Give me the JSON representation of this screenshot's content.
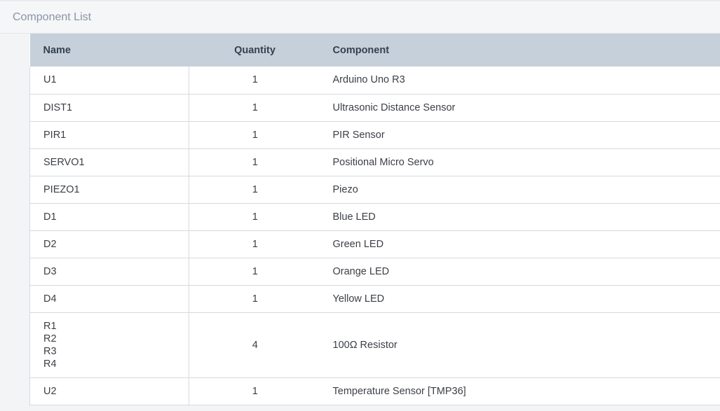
{
  "header": {
    "title": "Component List"
  },
  "table": {
    "columns": {
      "name": "Name",
      "quantity": "Quantity",
      "component": "Component"
    },
    "rows": [
      {
        "names": [
          "U1"
        ],
        "quantity": "1",
        "component": "Arduino Uno R3"
      },
      {
        "names": [
          "DIST1"
        ],
        "quantity": "1",
        "component": "Ultrasonic Distance Sensor"
      },
      {
        "names": [
          "PIR1"
        ],
        "quantity": "1",
        "component": "PIR Sensor"
      },
      {
        "names": [
          "SERVO1"
        ],
        "quantity": "1",
        "component": "Positional Micro Servo"
      },
      {
        "names": [
          "PIEZO1"
        ],
        "quantity": "1",
        "component": "Piezo"
      },
      {
        "names": [
          "D1"
        ],
        "quantity": "1",
        "component": "Blue LED"
      },
      {
        "names": [
          "D2"
        ],
        "quantity": "1",
        "component": "Green LED"
      },
      {
        "names": [
          "D3"
        ],
        "quantity": "1",
        "component": "Orange LED"
      },
      {
        "names": [
          "D4"
        ],
        "quantity": "1",
        "component": "Yellow LED"
      },
      {
        "names": [
          "R1",
          "R2",
          "R3",
          "R4"
        ],
        "quantity": "4",
        "component": "100Ω Resistor"
      },
      {
        "names": [
          "U2"
        ],
        "quantity": "1",
        "component": "Temperature Sensor [TMP36]"
      }
    ]
  }
}
